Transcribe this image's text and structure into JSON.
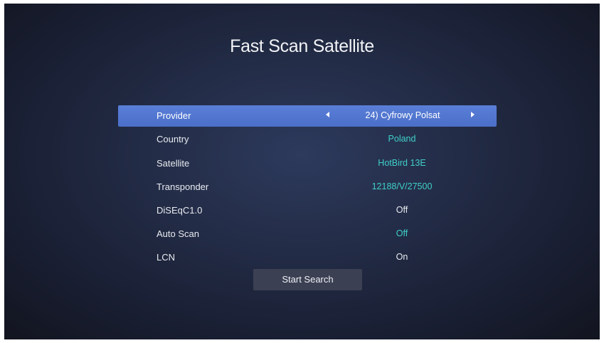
{
  "screen": {
    "title": "Fast Scan Satellite"
  },
  "settings": [
    {
      "label": "Provider",
      "value": "24) Cyfrowy Polsat",
      "value_color": "#ffffff",
      "selected": true
    },
    {
      "label": "Country",
      "value": "Poland",
      "value_color": "#3fcfc8"
    },
    {
      "label": "Satellite",
      "value": "HotBird 13E",
      "value_color": "#3fcfc8"
    },
    {
      "label": "Transponder",
      "value": "12188/V/27500",
      "value_color": "#3fcfc8"
    },
    {
      "label": "DiSEqC1.0",
      "value": "Off",
      "value_color": "#e9ebf0"
    },
    {
      "label": "Auto Scan",
      "value": "Off",
      "value_color": "#3fcfc8"
    },
    {
      "label": "LCN",
      "value": "On",
      "value_color": "#e9ebf0"
    }
  ],
  "actions": {
    "start_search_label": "Start Search"
  },
  "icons": {
    "prev": "chevron-left-icon",
    "next": "chevron-right-icon"
  },
  "colors": {
    "selection": "#5a7fd8",
    "accent_value": "#3fcfc8",
    "button": "#3b4053"
  }
}
